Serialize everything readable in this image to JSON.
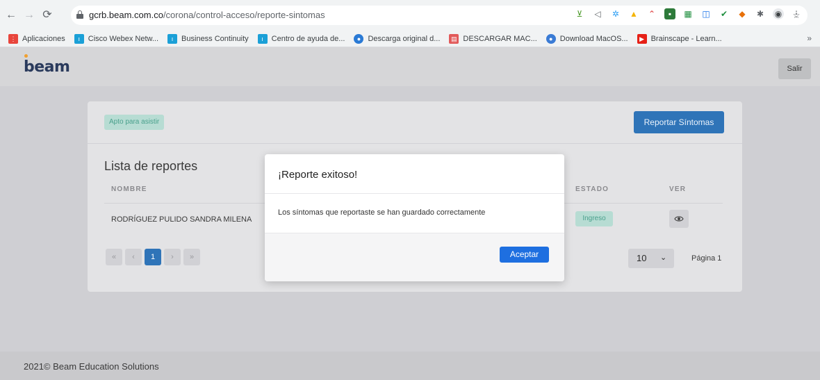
{
  "browser": {
    "url_host": "gcrb.beam.com.co",
    "url_path": "/corona/control-acceso/reporte-sintomas",
    "bookmarks": [
      {
        "label": "Aplicaciones",
        "icon": "apps-grid-icon",
        "color": "#e8453c"
      },
      {
        "label": "Cisco Webex Netw...",
        "icon": "cisco-icon",
        "color": "#1ba0d7"
      },
      {
        "label": "Business Continuity",
        "icon": "cisco-icon",
        "color": "#1ba0d7"
      },
      {
        "label": "Centro de ayuda de...",
        "icon": "cisco-icon",
        "color": "#1ba0d7"
      },
      {
        "label": "Descarga original d...",
        "icon": "globe-icon",
        "color": "#2a7ad5"
      },
      {
        "label": "DESCARGAR MAC...",
        "icon": "calendar-icon",
        "color": "#e25a5a"
      },
      {
        "label": "Download MacOS...",
        "icon": "apple-icon",
        "color": "#3a7bd5"
      },
      {
        "label": "Brainscape - Learn...",
        "icon": "youtube-icon",
        "color": "#e62117"
      }
    ],
    "more": "»"
  },
  "app": {
    "logo": "beam",
    "logout_label": "Salir"
  },
  "card": {
    "status_badge": "Apto para asistir",
    "report_button": "Reportar Síntomas",
    "list_title": "Lista de reportes",
    "columns": {
      "nombre": "NOMBRE",
      "estado": "ESTADO",
      "ver": "VER"
    },
    "rows": [
      {
        "nombre": "RODRÍGUEZ PULIDO SANDRA MILENA",
        "estado": "Ingreso"
      }
    ],
    "pagination": {
      "first": "«",
      "prev": "‹",
      "current": "1",
      "next": "›",
      "last": "»",
      "page_size": "10",
      "page_label": "Página 1"
    }
  },
  "footer": {
    "text": "2021© Beam Education Solutions"
  },
  "modal": {
    "title": "¡Reporte exitoso!",
    "body": "Los síntomas que reportaste se han guardado correctamente",
    "accept_label": "Aceptar"
  }
}
